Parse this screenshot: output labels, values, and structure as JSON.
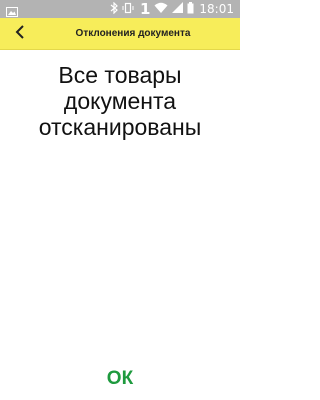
{
  "status_bar": {
    "time": "18:01",
    "sim_indicator": "1",
    "icons": [
      "image-icon",
      "bluetooth-icon",
      "vibrate-icon",
      "sim-icon",
      "wifi-icon",
      "signal-icon",
      "battery-icon"
    ],
    "background": "#b3b3b3"
  },
  "header": {
    "title": "Отклонения документа",
    "back_icon": "chevron-left-icon",
    "background": "#f7ed5a"
  },
  "main": {
    "message": "Все товары документа отсканированы"
  },
  "footer": {
    "ok_label": "ОК",
    "ok_color": "#1e9a3e"
  }
}
